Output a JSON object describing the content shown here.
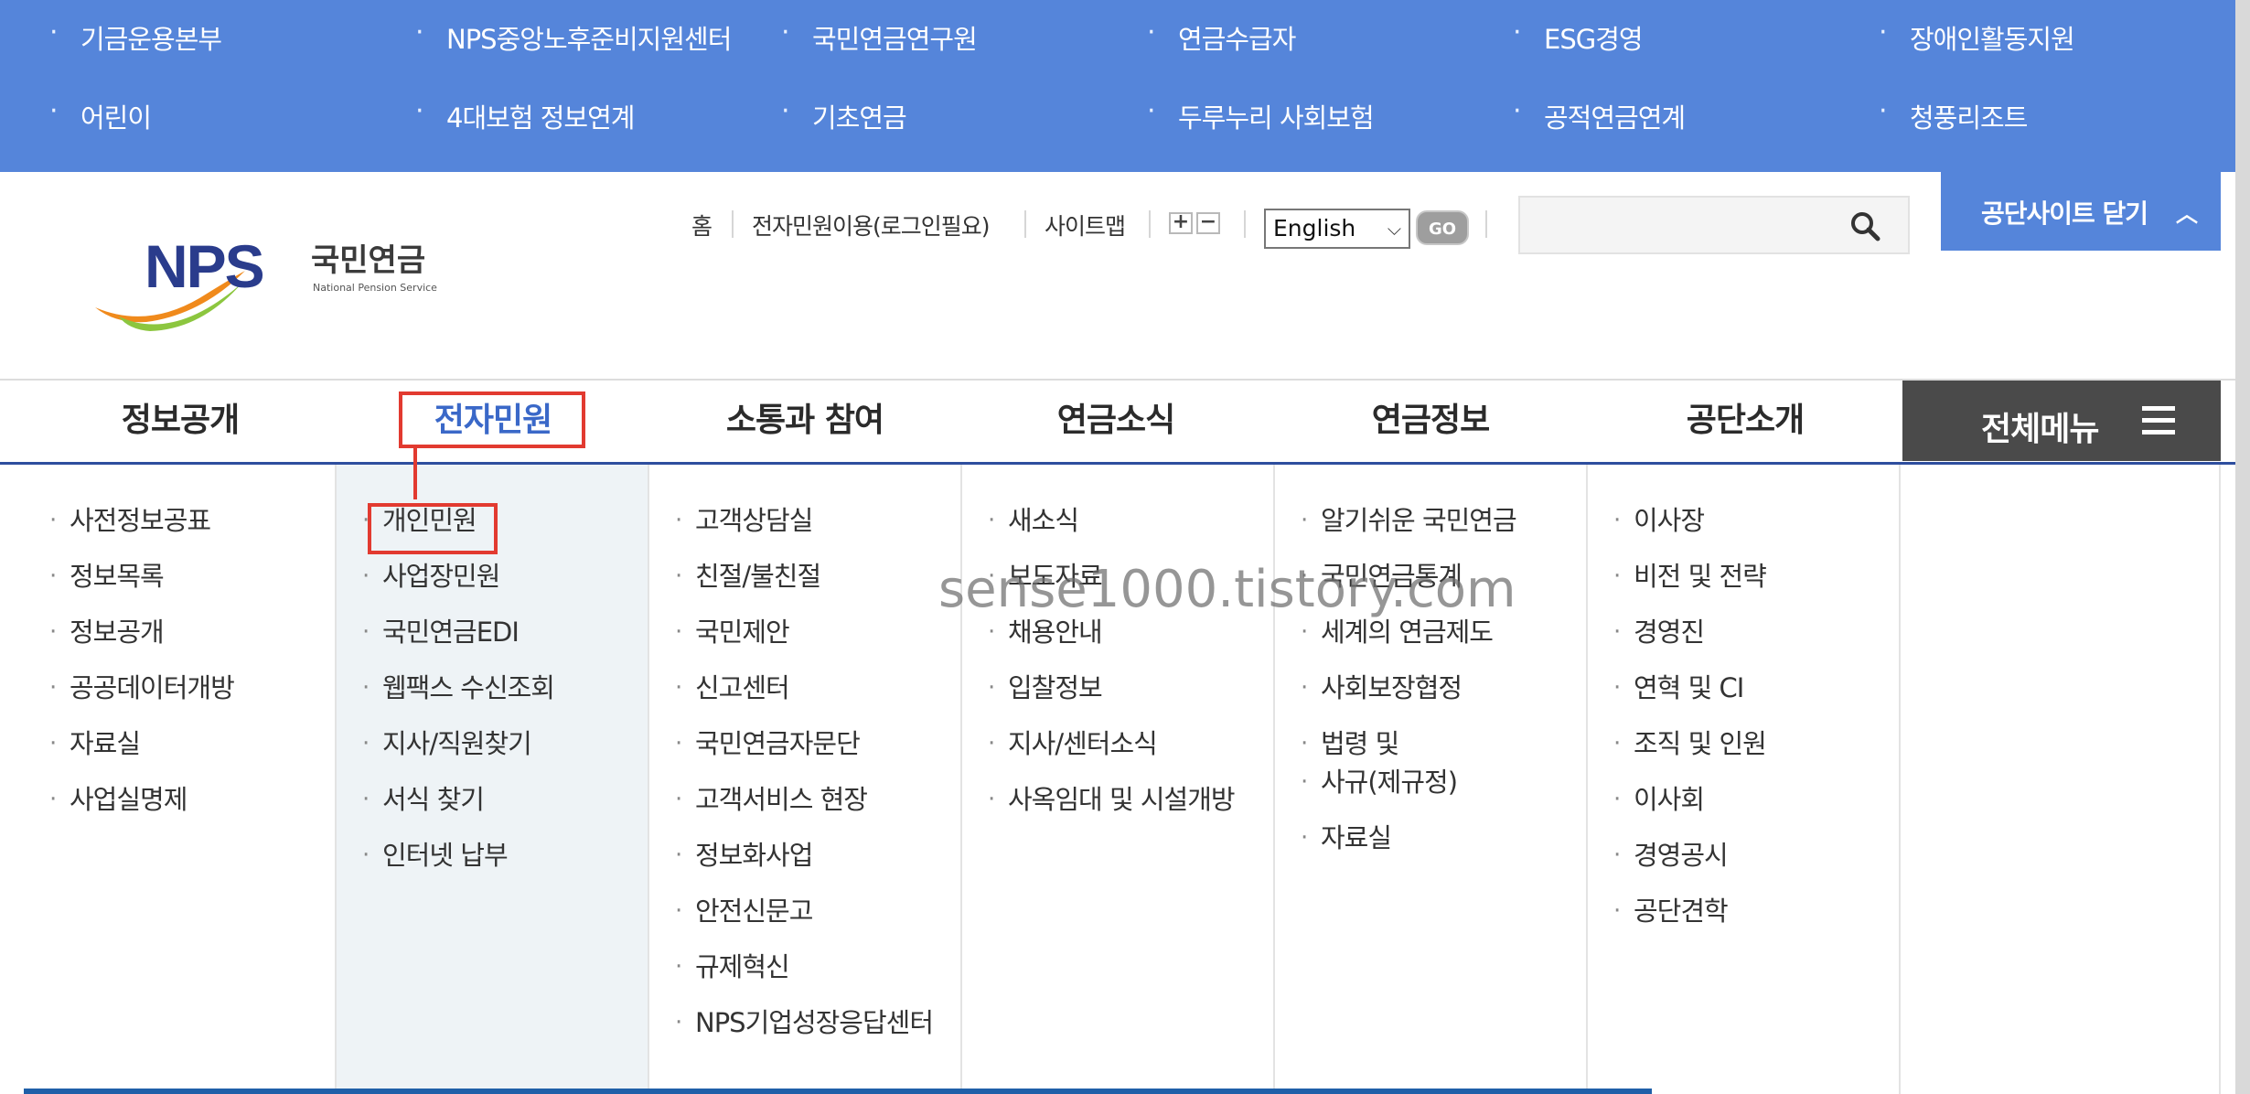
{
  "site_bar": {
    "row1": [
      "기금운용본부",
      "NPS중앙노후준비지원센터",
      "국민연금연구원",
      "연금수급자",
      "ESG경영",
      "장애인활동지원"
    ],
    "row2": [
      "어린이",
      "4대보험 정보연계",
      "기초연금",
      "두루누리 사회보험",
      "공적연금연계",
      "청풍리조트"
    ]
  },
  "logo": {
    "letters": "NPS",
    "korean": "국민연금",
    "english": "National Pension Service"
  },
  "utility": {
    "home": "홈",
    "e_civil": "전자민원이용(로그인필요)",
    "sitemap": "사이트맵",
    "font_plus": "+",
    "font_minus": "−",
    "language": "English",
    "go": "GO",
    "close_sites": "공단사이트 닫기"
  },
  "search": {
    "placeholder": ""
  },
  "nav": {
    "tabs": [
      "정보공개",
      "전자민원",
      "소통과 참여",
      "연금소식",
      "연금정보",
      "공단소개"
    ],
    "active_tab": "전자민원",
    "all_menu": "전체메뉴"
  },
  "dropdown": {
    "columns": [
      [
        "사전정보공표",
        "정보목록",
        "정보공개",
        "공공데이터개방",
        "자료실",
        "사업실명제"
      ],
      [
        "개인민원",
        "사업장민원",
        "국민연금EDI",
        "웹팩스 수신조회",
        "지사/직원찾기",
        "서식 찾기",
        "인터넷 납부"
      ],
      [
        "고객상담실",
        "친절/불친절",
        "국민제안",
        "신고센터",
        "국민연금자문단",
        "고객서비스 현장",
        "정보화사업",
        "안전신문고",
        "규제혁신",
        "NPS기업성장응답센터"
      ],
      [
        "새소식",
        "보도자료",
        "채용안내",
        "입찰정보",
        "지사/센터소식",
        "사옥임대 및 시설개방"
      ],
      [
        "알기쉬운 국민연금",
        "국민연금통계",
        "세계의 연금제도",
        "사회보장협정",
        "법령 및",
        "사규(제규정)",
        "자료실"
      ],
      [
        "이사장",
        "비전 및 전략",
        "경영진",
        "연혁 및 CI",
        "조직 및 인원",
        "이사회",
        "경영공시",
        "공단견학"
      ]
    ]
  },
  "watermark": "sense1000.tistory.com",
  "colors": {
    "site_bar": "#5585da",
    "active_tab": "#3a68c8",
    "highlight": "#e23a30",
    "all_menu_bg": "#4a4a4a",
    "nav_underline": "#2e4e9e"
  }
}
